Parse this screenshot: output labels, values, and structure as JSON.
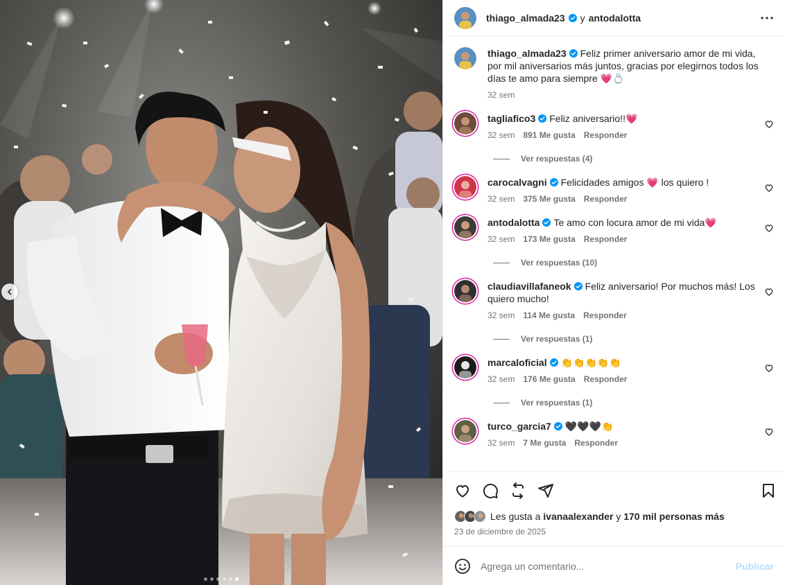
{
  "post": {
    "author": "thiago_almada23",
    "connector": "y",
    "coauthor": "antodalotta"
  },
  "caption": {
    "user": "thiago_almada23",
    "text": "Feliz primer aniversario amor de mi vida, por mil aniversarios más juntos, gracias por elegirnos todos los días te amo para siempre 💗💍",
    "time": "32 sem"
  },
  "comments": [
    {
      "user": "tagliafico3",
      "text": "Feliz aniversario!!💗",
      "time": "32 sem",
      "likes": "891 Me gusta",
      "reply": "Responder",
      "replies": "Ver respuestas (4)"
    },
    {
      "user": "carocalvagni",
      "text": "Felicidades amigos 💗 los quiero !",
      "time": "32 sem",
      "likes": "375 Me gusta",
      "reply": "Responder",
      "replies": ""
    },
    {
      "user": "antodalotta",
      "text": "Te amo con locura amor de mi vida💗",
      "time": "32 sem",
      "likes": "173 Me gusta",
      "reply": "Responder",
      "replies": "Ver respuestas (10)"
    },
    {
      "user": "claudiavillafaneok",
      "text": "Feliz aniversario! Por muchos más! Los quiero mucho!",
      "time": "32 sem",
      "likes": "114 Me gusta",
      "reply": "Responder",
      "replies": "Ver respuestas (1)"
    },
    {
      "user": "marcaloficial",
      "text": "👏👏👏👏👏",
      "time": "32 sem",
      "likes": "176 Me gusta",
      "reply": "Responder",
      "replies": "Ver respuestas (1)"
    },
    {
      "user": "turco_garcia7",
      "text": "🖤🖤🖤👏",
      "time": "32 sem",
      "likes": "7 Me gusta",
      "reply": "Responder",
      "replies": ""
    }
  ],
  "likes_line": {
    "prefix": "Les gusta a",
    "user": "ivanaalexander",
    "connector": "y",
    "others": "170 mil personas más"
  },
  "date": "23 de diciembre de 2025",
  "add_comment": {
    "placeholder": "Agrega un comentario...",
    "publish": "Publicar"
  },
  "carousel": {
    "count": 6,
    "active_index": 5
  },
  "colors": {
    "verified": "#0095f6",
    "publish_disabled": "#b2dffc",
    "secondary_text": "#737373"
  }
}
